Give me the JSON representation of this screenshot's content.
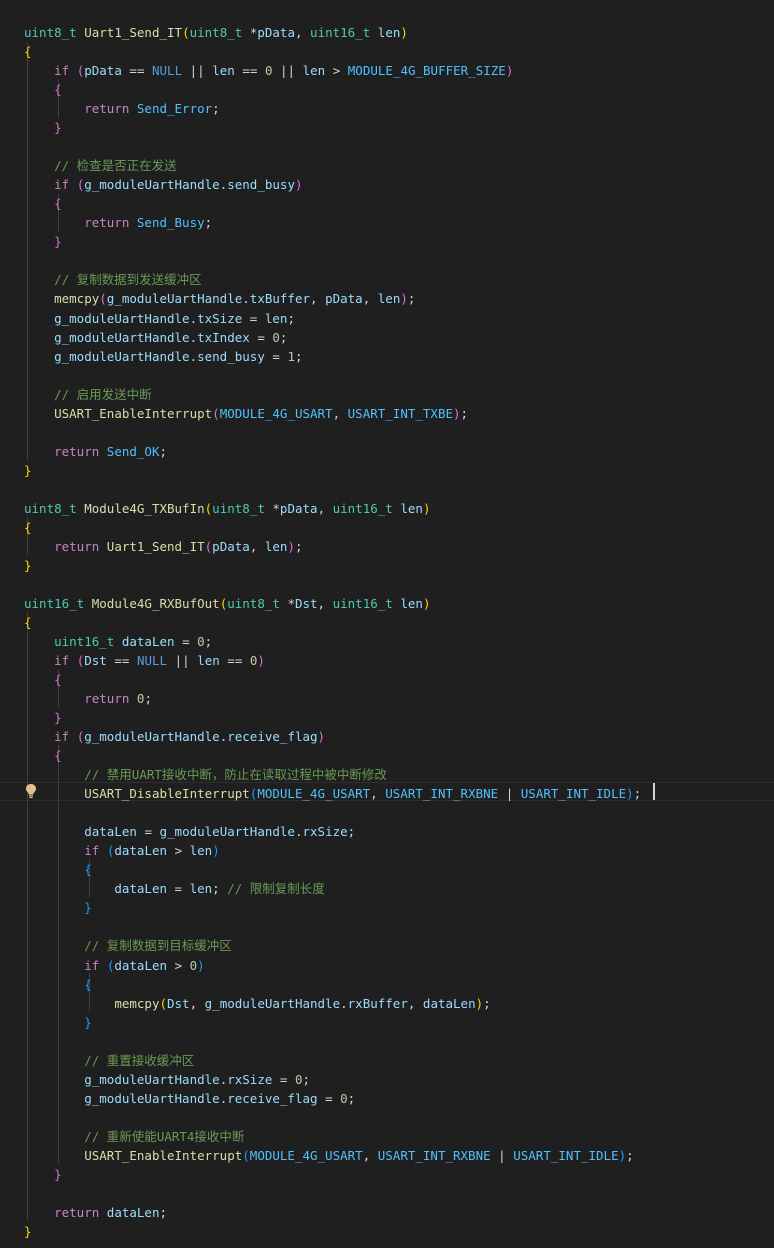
{
  "editor": {
    "language": "c",
    "theme_colors": {
      "background": "#1f1f1f",
      "keyword": "#c586c0",
      "type": "#4ec9b0",
      "function": "#dcdcaa",
      "variable": "#9cdcfe",
      "comment": "#6a9955",
      "number": "#b5cea8",
      "macro": "#4fc1ff",
      "null": "#569cd6"
    },
    "lightbulb_icon": "lightbulb-icon",
    "lines": [
      "uint8_t Uart1_Send_IT(uint8_t *pData, uint16_t len)",
      "{",
      "    if (pData == NULL || len == 0 || len > MODULE_4G_BUFFER_SIZE)",
      "    {",
      "        return Send_Error;",
      "    }",
      "",
      "    // 检查是否正在发送",
      "    if (g_moduleUartHandle.send_busy)",
      "    {",
      "        return Send_Busy;",
      "    }",
      "",
      "    // 复制数据到发送缓冲区",
      "    memcpy(g_moduleUartHandle.txBuffer, pData, len);",
      "    g_moduleUartHandle.txSize = len;",
      "    g_moduleUartHandle.txIndex = 0;",
      "    g_moduleUartHandle.send_busy = 1;",
      "",
      "    // 启用发送中断",
      "    USART_EnableInterrupt(MODULE_4G_USART, USART_INT_TXBE);",
      "",
      "    return Send_OK;",
      "}",
      "",
      "uint8_t Module4G_TXBufIn(uint8_t *pData, uint16_t len)",
      "{",
      "    return Uart1_Send_IT(pData, len);",
      "}",
      "",
      "uint16_t Module4G_RXBufOut(uint8_t *Dst, uint16_t len)",
      "{",
      "    uint16_t dataLen = 0;",
      "    if (Dst == NULL || len == 0)",
      "    {",
      "        return 0;",
      "    }",
      "    if (g_moduleUartHandle.receive_flag)",
      "    {",
      "        // 禁用UART接收中断，防止在读取过程中被中断修改",
      "        USART_DisableInterrupt(MODULE_4G_USART, USART_INT_RXBNE | USART_INT_IDLE);",
      "",
      "        dataLen = g_moduleUartHandle.rxSize;",
      "        if (dataLen > len)",
      "        {",
      "            dataLen = len; // 限制复制长度",
      "        }",
      "",
      "        // 复制数据到目标缓冲区",
      "        if (dataLen > 0)",
      "        {",
      "            memcpy(Dst, g_moduleUartHandle.rxBuffer, dataLen);",
      "        }",
      "",
      "        // 重置接收缓冲区",
      "        g_moduleUartHandle.rxSize = 0;",
      "        g_moduleUartHandle.receive_flag = 0;",
      "",
      "        // 重新使能UART4接收中断",
      "        USART_EnableInterrupt(MODULE_4G_USART, USART_INT_RXBNE | USART_INT_IDLE);",
      "    }",
      "",
      "    return dataLen;",
      "}"
    ]
  }
}
